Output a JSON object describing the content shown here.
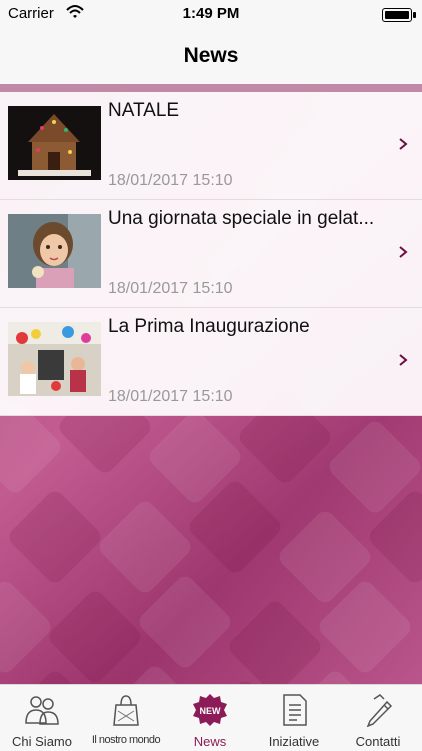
{
  "status": {
    "carrier": "Carrier",
    "time": "1:49 PM",
    "battery_level": 1.0
  },
  "header": {
    "title": "News"
  },
  "colors": {
    "accent": "#8c1c58",
    "background": "#b24a85"
  },
  "news": [
    {
      "title": "NATALE",
      "date": "18/01/2017 15:10",
      "thumb": "gingerbread-house"
    },
    {
      "title": "Una giornata speciale in gelat...",
      "date": "18/01/2017 15:10",
      "thumb": "child-photo"
    },
    {
      "title": "La Prima Inaugurazione",
      "date": "18/01/2017 15:10",
      "thumb": "party-photo"
    }
  ],
  "tabs": [
    {
      "label": "Chi Siamo",
      "icon": "people-icon"
    },
    {
      "label": "Il nostro mondo",
      "icon": "shopping-bag-icon"
    },
    {
      "label": "News",
      "icon": "new-badge-icon",
      "active": true
    },
    {
      "label": "Iniziative",
      "icon": "document-icon"
    },
    {
      "label": "Contatti",
      "icon": "pen-icon"
    }
  ]
}
